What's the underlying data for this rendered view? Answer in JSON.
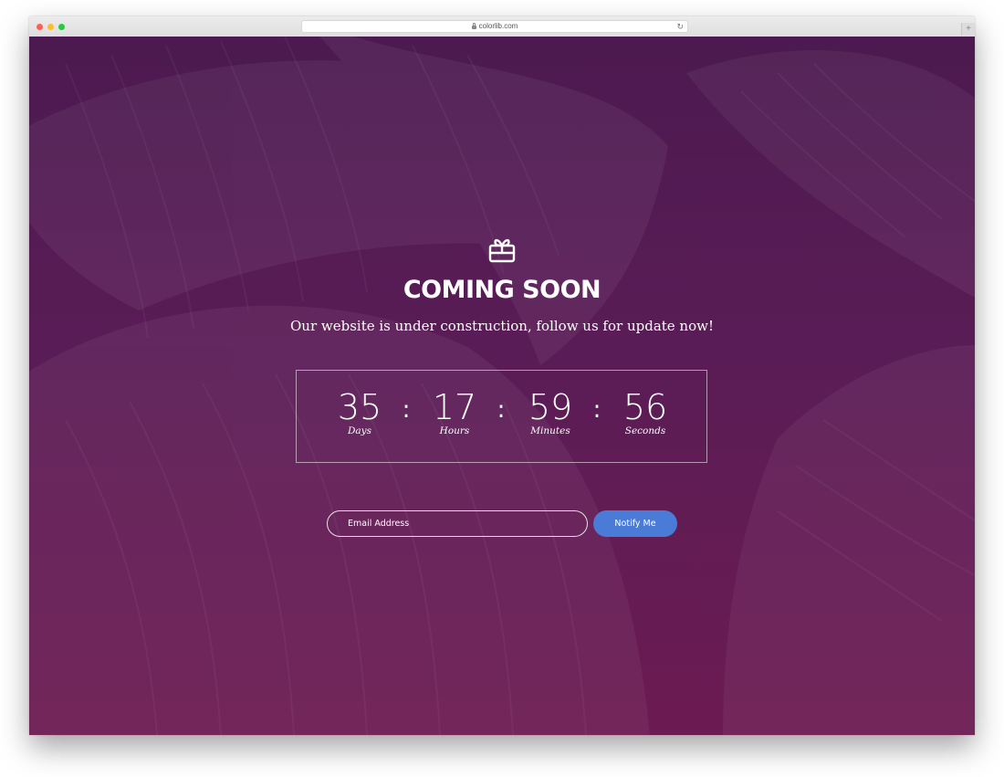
{
  "browser": {
    "url": "colorlib.com"
  },
  "page": {
    "title": "COMING SOON",
    "subtitle": "Our website is under construction, follow us for update now!",
    "icon": "gift-icon"
  },
  "countdown": {
    "units": [
      {
        "value": "35",
        "label": "Days"
      },
      {
        "value": "17",
        "label": "Hours"
      },
      {
        "value": "59",
        "label": "Minutes"
      },
      {
        "value": "56",
        "label": "Seconds"
      }
    ],
    "separator": ":"
  },
  "subscribe": {
    "email_placeholder": "Email Address",
    "button_label": "Notify Me"
  },
  "colors": {
    "background_top": "#4c1a50",
    "background_bottom": "#6c1b52",
    "button": "#4a7bd6"
  }
}
